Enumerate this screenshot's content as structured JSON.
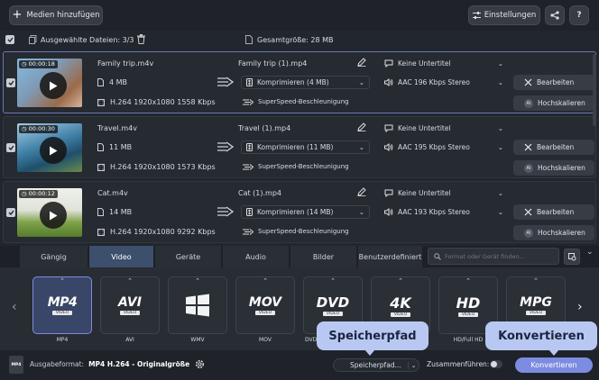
{
  "toolbar": {
    "add_media": "Medien hinzufügen",
    "settings": "Einstellungen",
    "help": "?"
  },
  "selection": {
    "selected_label": "Ausgewählte Dateien: 3/3",
    "total_size": "Gesamtgröße: 28 MB"
  },
  "files": [
    {
      "duration": "00:00:18",
      "name": "Family trip.m4v",
      "size": "4 MB",
      "codec": "H.264 1920x1080 1558 Kbps",
      "output_name": "Family trip (1).mp4",
      "compress": "Komprimieren (4 MB)",
      "superspeed": "SuperSpeed-Beschleunigung",
      "subtitles": "Keine Untertitel",
      "audio": "AAC 196 Kbps Stereo",
      "edit": "Bearbeiten",
      "upscale": "Hochskalieren"
    },
    {
      "duration": "00:00:30",
      "name": "Travel.m4v",
      "size": "11 MB",
      "codec": "H.264 1920x1080 1573 Kbps",
      "output_name": "Travel (1).mp4",
      "compress": "Komprimieren (11 MB)",
      "superspeed": "SuperSpeed-Beschleunigung",
      "subtitles": "Keine Untertitel",
      "audio": "AAC 195 Kbps Stereo",
      "edit": "Bearbeiten",
      "upscale": "Hochskalieren"
    },
    {
      "duration": "00:00:12",
      "name": "Cat.m4v",
      "size": "14 MB",
      "codec": "H.264 1920x1080 9292 Kbps",
      "output_name": "Cat (1).mp4",
      "compress": "Komprimieren (14 MB)",
      "superspeed": "SuperSpeed-Beschleunigung",
      "subtitles": "Keine Untertitel",
      "audio": "AAC 193 Kbps Stereo",
      "edit": "Bearbeiten",
      "upscale": "Hochskalieren"
    }
  ],
  "tabs": [
    "Gängig",
    "Video",
    "Geräte",
    "Audio",
    "Bilder",
    "Benutzerdefiniert"
  ],
  "active_tab": "Video",
  "search": {
    "placeholder": "Format oder Gerät finden..."
  },
  "formats": [
    {
      "logo": "MP4",
      "sub": "VIDEO",
      "label": "MP4"
    },
    {
      "logo": "AVI",
      "sub": "VIDEO",
      "label": "AVI"
    },
    {
      "logo": "",
      "sub": "",
      "label": "WMV"
    },
    {
      "logo": "MOV",
      "sub": "VIDEO",
      "label": "MOV"
    },
    {
      "logo": "DVD",
      "sub": "VIDEO",
      "label": "DVD-"
    },
    {
      "logo": "4K",
      "sub": "VIDEO",
      "label": ""
    },
    {
      "logo": "HD",
      "sub": "VIDEO",
      "label": "HD/Full HD"
    },
    {
      "logo": "MPG",
      "sub": "VIDEO",
      "label": ""
    }
  ],
  "bottom": {
    "format_prefix": "Ausgabeformat:",
    "format_value": "MP4 H.264 - Originalgröße",
    "save_path": "Speicherpfad...",
    "merge": "Zusammenführen:",
    "convert": "Konvertieren",
    "badge": "MP4"
  },
  "tooltips": {
    "save_path": "Speicherpfad",
    "convert": "Konvertieren"
  },
  "colors": {
    "accent": "#7c8ce0",
    "background": "#22262d",
    "tooltip": "#b9c8f2"
  }
}
